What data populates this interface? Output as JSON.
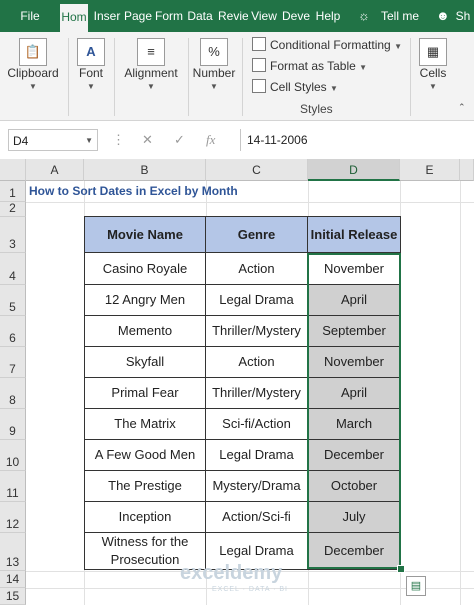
{
  "ribbon_tabs": {
    "file": "File",
    "home": "Hom",
    "insert": "Inser",
    "page_layout": "Page",
    "formulas": "Form",
    "data": "Data",
    "review": "Revie",
    "view": "View",
    "developer": "Deve",
    "help": "Help",
    "tell_me": "Tell me",
    "share": "Sh"
  },
  "ribbon": {
    "clipboard": "Clipboard",
    "font": "Font",
    "alignment": "Alignment",
    "number": "Number",
    "conditional_formatting": "Conditional Formatting",
    "format_as_table": "Format as Table",
    "cell_styles": "Cell Styles",
    "styles_group": "Styles",
    "cells": "Cells",
    "clipboard_icon_name": "clipboard-icon",
    "font_icon_text": "A",
    "alignment_icon_text": "≡",
    "number_icon_text": "%"
  },
  "formula_bar": {
    "name_box": "D4",
    "fx": "fx",
    "value": "14-11-2006"
  },
  "columns": [
    "A",
    "B",
    "C",
    "D",
    "E"
  ],
  "rows": [
    "1",
    "2",
    "3",
    "4",
    "5",
    "6",
    "7",
    "8",
    "9",
    "10",
    "11",
    "12",
    "13",
    "14",
    "15"
  ],
  "sheet_title": "How to Sort Dates in Excel by Month",
  "table": {
    "headers": [
      "Movie Name",
      "Genre",
      "Initial Release"
    ],
    "rows": [
      [
        "Casino Royale",
        "Action",
        "November"
      ],
      [
        "12 Angry Men",
        "Legal Drama",
        "April"
      ],
      [
        "Memento",
        "Thriller/Mystery",
        "September"
      ],
      [
        "Skyfall",
        "Action",
        "November"
      ],
      [
        "Primal Fear",
        "Thriller/Mystery",
        "April"
      ],
      [
        "The Matrix",
        "Sci-fi/Action",
        "March"
      ],
      [
        "A Few Good Men",
        "Legal Drama",
        "December"
      ],
      [
        "The Prestige",
        "Mystery/Drama",
        "October"
      ],
      [
        "Inception",
        "Action/Sci-fi",
        "July"
      ],
      [
        "Witness for the Prosecution",
        "Legal Drama",
        "December"
      ]
    ]
  },
  "watermark": {
    "name": "exceldemy",
    "tagline": "EXCEL · DATA · BI"
  },
  "colors": {
    "excel_green": "#217346",
    "header_fill": "#b4c6e7",
    "selected_fill": "#d0d0d0",
    "title_text": "#2f5597"
  }
}
